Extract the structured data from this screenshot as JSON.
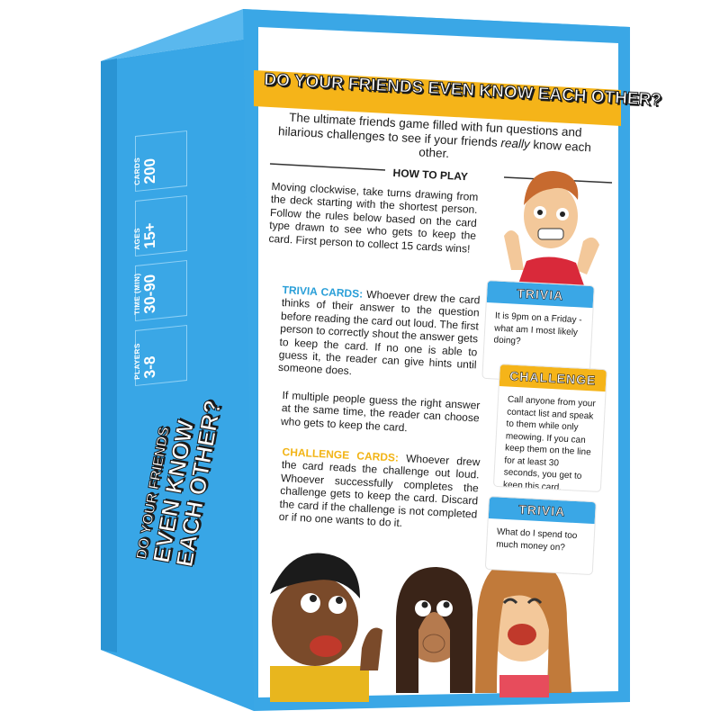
{
  "box": {
    "title": "DO YOUR FRIENDS EVEN KNOW EACH OTHER?",
    "tagline_part1": "The ultimate friends game filled with fun questions and hilarious challenges to see if your friends ",
    "tagline_emph": "really",
    "tagline_part2": " know each other.",
    "how_to_play": "HOW TO PLAY",
    "intro": "Moving clockwise, take turns drawing from the deck starting with the shortest person. Follow the rules below based on the card type drawn to see who gets to keep the card. First person to collect 15 cards wins!",
    "trivia_label": "TRIVIA CARDS:",
    "trivia_text": " Whoever drew the card thinks of their answer to the question before reading the card out loud. The first person to correctly shout the answer gets to keep the card. If no one is able to guess it, the reader can give hints until someone does.",
    "multiple_text": "If multiple people guess the right answer at the same time, the reader can choose who gets to keep the card.",
    "challenge_label": "CHALLENGE CARDS:",
    "challenge_text": " Whoever drew the card reads the challenge out loud. Whoever successfully completes the challenge gets to keep the card. Discard the card if the challenge is not completed or if no one wants to do it."
  },
  "side": {
    "stats": [
      {
        "label": "CARDS",
        "value": "200"
      },
      {
        "label": "AGES",
        "value": "15+"
      },
      {
        "label": "TIME (MIN)",
        "value": "30-90"
      },
      {
        "label": "PLAYERS",
        "value": "3-8"
      }
    ],
    "title_l1": "DO YOUR FRIENDS",
    "title_l2": "EVEN KNOW",
    "title_l3": "EACH OTHER?"
  },
  "cards": [
    {
      "type": "TRIVIA",
      "text": "It is 9pm on a Friday - what am I most likely doing?"
    },
    {
      "type": "CHALLENGE",
      "text": "Call anyone from your contact list and speak to them while only meowing. If you can keep them on the line for at least 30 seconds, you get to keep this card."
    },
    {
      "type": "TRIVIA",
      "text": "What do I spend too much money on?"
    }
  ],
  "colors": {
    "box_blue": "#3aa7e6",
    "box_blue_dark": "#1f8ccc",
    "banner_yellow": "#f5b419",
    "trivia_blue": "#2a9fd8",
    "challenge_yellow": "#f2b416"
  }
}
